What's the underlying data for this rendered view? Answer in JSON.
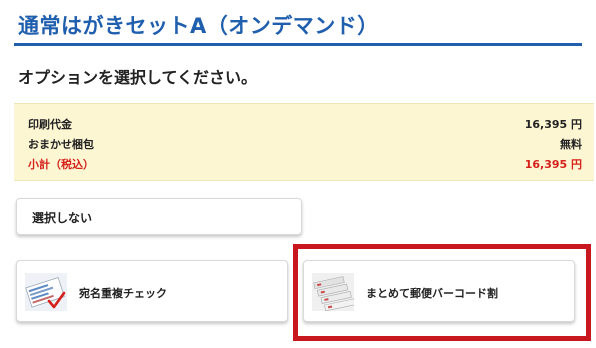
{
  "header": {
    "title": "通常はがきセットA（オンデマンド）",
    "subtitle": "オプションを選択してください。"
  },
  "summary": {
    "rows": [
      {
        "label": "印刷代金",
        "value": "16,395 円"
      },
      {
        "label": "おまかせ梱包",
        "value": "無料"
      },
      {
        "label": "小計（税込）",
        "value": "16,395 円"
      }
    ]
  },
  "options": {
    "none_label": "選択しない",
    "items": [
      {
        "label": "宛名重複チェック",
        "icon": "address-check-thumbnail-icon"
      },
      {
        "label": "まとめて郵便バーコード割",
        "icon": "postal-barcode-thumbnail-icon"
      }
    ]
  },
  "colors": {
    "accent": "#1f5fae",
    "summary_bg": "#fdf6d3",
    "subtotal": "#d5201b",
    "highlight": "#c8171e"
  }
}
